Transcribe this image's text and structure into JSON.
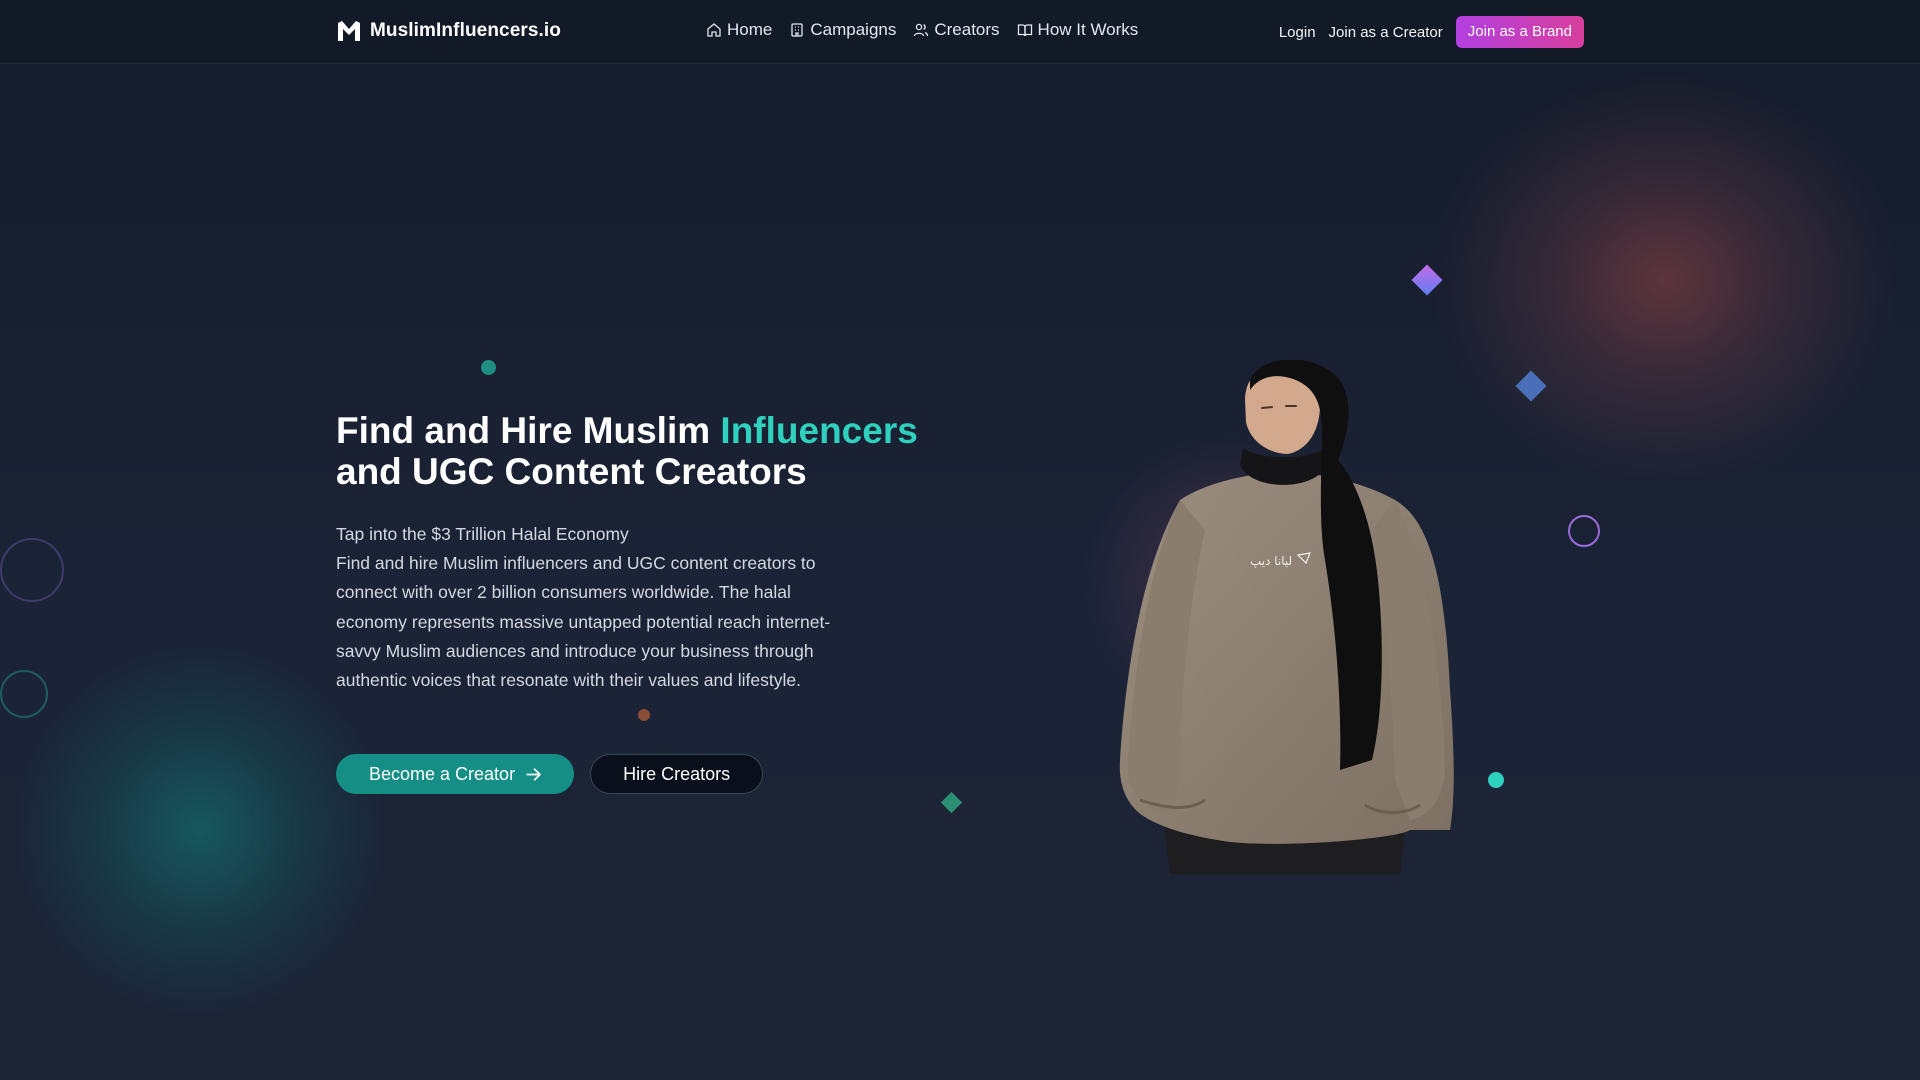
{
  "nav": {
    "logo_text": "MuslimInfluencers.io",
    "links": [
      {
        "label": "Home",
        "icon": "home-icon"
      },
      {
        "label": "Campaigns",
        "icon": "building-icon"
      },
      {
        "label": "Creators",
        "icon": "users-icon"
      },
      {
        "label": "How It Works",
        "icon": "book-icon"
      }
    ],
    "login": "Login",
    "join_creator": "Join as a Creator",
    "join_brand": "Join as a Brand"
  },
  "hero": {
    "title_part1": "Find and Hire Muslim ",
    "title_accent": "Influencers",
    "title_part2": "and UGC Content Creators",
    "subtitle_line1": "Tap into the $3 Trillion Halal Economy",
    "subtitle_body": "Find and hire Muslim influencers and UGC content creators to connect with over 2 billion consumers worldwide. The halal economy represents massive untapped potential reach internet-savvy Muslim audiences and introduce your business through authentic voices that resonate with their values and lifestyle.",
    "primary_button": "Become a Creator",
    "secondary_button": "Hire Creators",
    "image_caption_text": "ليانا ديپ"
  },
  "colors": {
    "accent_teal": "#2fd0bd",
    "primary_button": "#158f85",
    "brand_button_start": "#b23fe0",
    "brand_button_end": "#d83f9d",
    "background": "#1a2133"
  }
}
